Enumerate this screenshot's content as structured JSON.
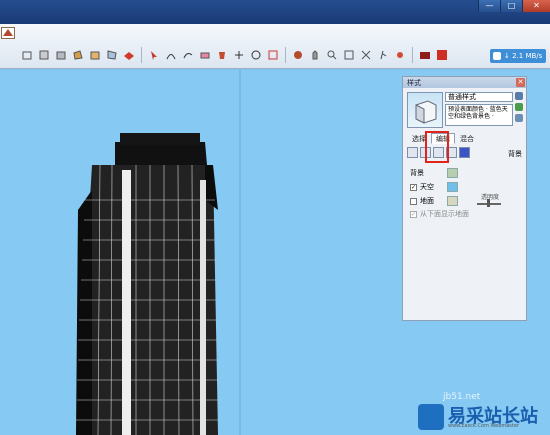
{
  "window": {
    "controls": [
      "—",
      "□",
      "✕"
    ]
  },
  "toolbar": {
    "netspeed": "↓ 2.1 MB/s"
  },
  "tray": {
    "title": "样式",
    "style_name": "普通样式",
    "style_desc": "预设表面颜色 · 蓝色天空和绿色背景色 ·",
    "tabs": [
      {
        "label": "选择",
        "active": false
      },
      {
        "label": "编辑",
        "active": true
      },
      {
        "label": "混合",
        "active": false
      }
    ],
    "section_label": "背景",
    "background_heading": "背景",
    "rows": [
      {
        "label": "天空",
        "checked": true,
        "swatch": "#6fbfe8"
      },
      {
        "label": "地面",
        "checked": false,
        "swatch": "#d7d8bd"
      },
      {
        "label": "从下面显示地面",
        "checked": true,
        "disabled": true
      }
    ],
    "background_swatch": "#b6cdb0",
    "transparency_label": "透明度"
  },
  "watermark": {
    "url": "jb51.net",
    "text": "易采站长站",
    "sub": "www.Easck.Com Webmaster"
  },
  "colors": {
    "sky": "#86c9f2",
    "building": "#1a1a1a",
    "highlight": "#e0241b"
  }
}
